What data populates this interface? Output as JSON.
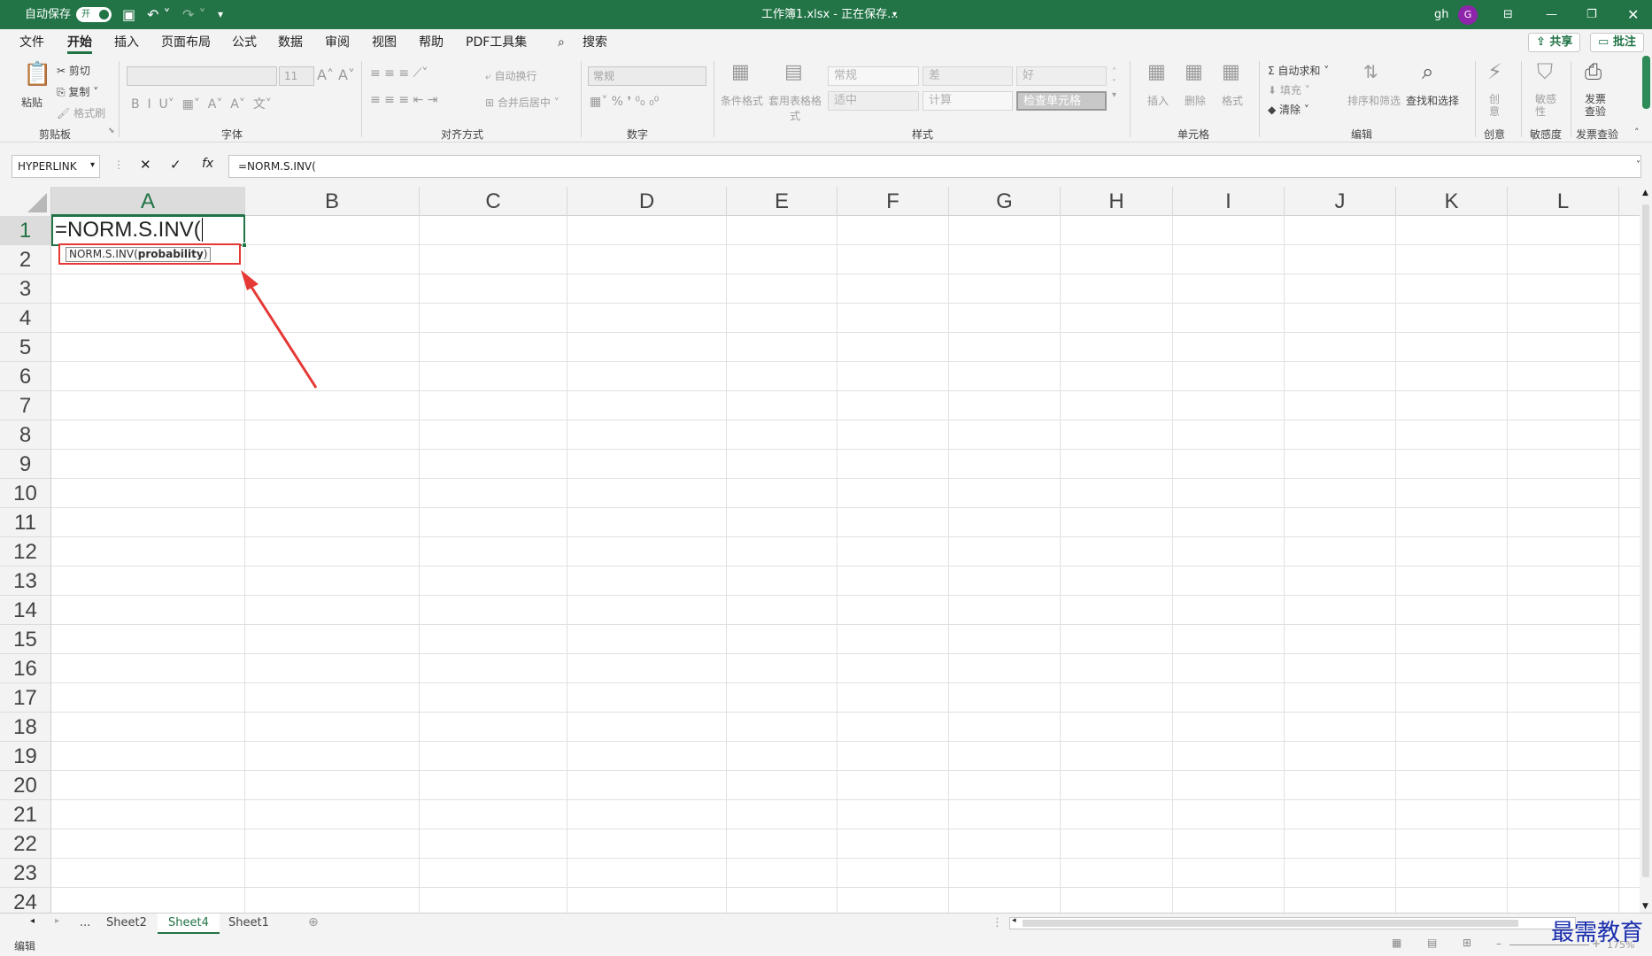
{
  "titlebar": {
    "autosave": "自动保存",
    "toggle": "开",
    "filename": "工作簿1.xlsx - 正在保存...",
    "user": "gh",
    "avatar": "G"
  },
  "menu": {
    "tabs": [
      "文件",
      "开始",
      "插入",
      "页面布局",
      "公式",
      "数据",
      "审阅",
      "视图",
      "帮助",
      "PDF工具集"
    ],
    "search": "搜索",
    "share": "共享",
    "comments": "批注"
  },
  "ribbon": {
    "clipboard": {
      "paste": "粘贴",
      "cut": "剪切",
      "copy": "复制",
      "format_painter": "格式刷",
      "label": "剪贴板"
    },
    "font": {
      "size": "11",
      "label": "字体"
    },
    "alignment": {
      "wrap": "自动换行",
      "merge": "合并后居中",
      "label": "对齐方式"
    },
    "number": {
      "format": "常规",
      "label": "数字"
    },
    "styles": {
      "cond": "条件格式",
      "table": "套用表格格式",
      "normal": "常规",
      "bad": "差",
      "good": "好",
      "neutral": "适中",
      "calc": "计算",
      "check": "检查单元格",
      "label": "样式"
    },
    "cells": {
      "insert": "插入",
      "delete": "删除",
      "format": "格式",
      "label": "单元格"
    },
    "editing": {
      "autosum": "自动求和",
      "fill": "填充",
      "clear": "清除",
      "sort": "排序和筛选",
      "find": "查找和选择",
      "label": "编辑"
    },
    "creative": {
      "btn": "创意",
      "label": "创意"
    },
    "sensitivity": {
      "btn": "敏感性",
      "label": "敏感度"
    },
    "invoice": {
      "btn": "发票查验",
      "label": "发票查验"
    }
  },
  "formula_bar": {
    "name_box": "HYPERLINK",
    "fx": "fx",
    "formula": "=NORM.S.INV("
  },
  "grid": {
    "columns": [
      "A",
      "B",
      "C",
      "D",
      "E",
      "F",
      "G",
      "H",
      "I",
      "J",
      "K",
      "L"
    ],
    "rows": [
      "1",
      "2",
      "3",
      "4",
      "5",
      "6",
      "7",
      "8",
      "9",
      "10",
      "11",
      "12",
      "13",
      "14",
      "15",
      "16",
      "17",
      "18",
      "19",
      "20",
      "21",
      "22",
      "23",
      "24"
    ],
    "a1": "=NORM.S.INV(",
    "tooltip_fn": "NORM.S.INV(",
    "tooltip_arg": "probability",
    "tooltip_end": ")"
  },
  "sheets": {
    "more": "...",
    "tabs": [
      "Sheet2",
      "Sheet4",
      "Sheet1"
    ],
    "active": "Sheet4"
  },
  "status": {
    "mode": "编辑",
    "zoom": "175%"
  },
  "watermark": "最需教育",
  "colors": {
    "accent": "#217346",
    "annotation": "#e53935"
  }
}
